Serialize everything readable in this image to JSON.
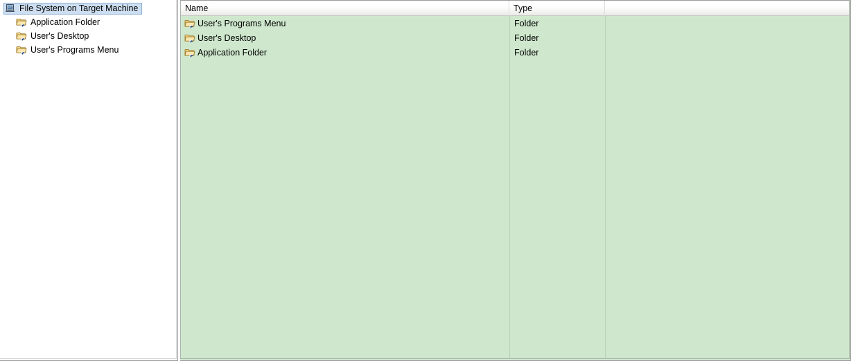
{
  "tree": {
    "root": {
      "label": "File System on Target Machine",
      "icon": "computer-icon",
      "selected": true
    },
    "children": [
      {
        "label": "Application Folder",
        "icon": "folder-shortcut-icon"
      },
      {
        "label": "User's Desktop",
        "icon": "folder-shortcut-icon"
      },
      {
        "label": "User's Programs Menu",
        "icon": "folder-shortcut-icon"
      }
    ]
  },
  "list": {
    "columns": [
      {
        "key": "name",
        "label": "Name"
      },
      {
        "key": "type",
        "label": "Type"
      },
      {
        "key": "filler",
        "label": ""
      }
    ],
    "rows": [
      {
        "name": "User's Programs Menu",
        "type": "Folder",
        "icon": "folder-shortcut-icon"
      },
      {
        "name": "User's Desktop",
        "type": "Folder",
        "icon": "folder-shortcut-icon"
      },
      {
        "name": "Application Folder",
        "type": "Folder",
        "icon": "folder-shortcut-icon"
      }
    ]
  },
  "colors": {
    "list_background": "#cfe8cd",
    "tree_background": "#ffffff",
    "selection_fill": "#cddef0",
    "selection_border": "#8ab0d8",
    "header_gradient_top": "#ffffff",
    "header_gradient_bottom": "#eaeae6",
    "column_separator": "#b9cfb8",
    "folder_body": "#f6d98b",
    "folder_edge": "#a8822c",
    "shortcut_badge": "#2b5fb0"
  }
}
